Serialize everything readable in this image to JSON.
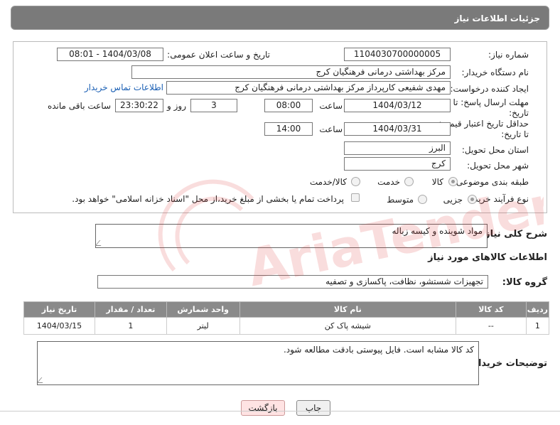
{
  "header": {
    "title": "جزئیات اطلاعات نیاز"
  },
  "form": {
    "need_number": {
      "label": "شماره نیاز:",
      "value": "1104030700000005"
    },
    "announce_datetime": {
      "label": "تاریخ و ساعت اعلان عمومی:",
      "value": "1404/03/08 - 08:01"
    },
    "buyer_org": {
      "label": "نام دستگاه خریدار:",
      "value": "مرکز بهداشتی درمانی فرهنگیان کرج"
    },
    "requester": {
      "label": "ایجاد کننده درخواست:",
      "value": "مهدی شفیعی کارپرداز مرکز بهداشتی درمانی فرهنگیان کرج",
      "contact_link": "اطلاعات تماس خریدار"
    },
    "reply_deadline": {
      "label_line1": "مهلت ارسال پاسخ: تا",
      "label_line2": "تاریخ:",
      "date": "1404/03/12",
      "time_label": "ساعت",
      "time": "08:00",
      "days_value": "3",
      "days_label": "روز و",
      "remaining_time": "23:30:22",
      "remaining_label": "ساعت باقی مانده"
    },
    "price_validity": {
      "label_line1": "حداقل تاریخ اعتبار قیمت:",
      "label_line2": "تا تاریخ:",
      "date": "1404/03/31",
      "time_label": "ساعت",
      "time": "14:00"
    },
    "delivery_province": {
      "label": "استان محل تحویل:",
      "value": "البرز"
    },
    "delivery_city": {
      "label": "شهر محل تحویل:",
      "value": "کرج"
    },
    "category": {
      "label": "طبقه بندی موضوعی:",
      "options": [
        "کالا",
        "خدمت",
        "کالا/خدمت"
      ],
      "selected": "کالا"
    },
    "purchase_type": {
      "label": "نوع فرآیند خرید :",
      "options": [
        "جزیی",
        "متوسط"
      ],
      "selected": "جزیی",
      "payment_note": "پرداخت تمام یا بخشی از مبلغ خرید،از محل \"اسناد خزانه اسلامی\" خواهد بود."
    }
  },
  "description": {
    "label": "شرح کلی نیاز:",
    "value": "مواد شوینده و کیسه زباله"
  },
  "goods_section": {
    "title": "اطلاعات کالاهای مورد نیاز"
  },
  "goods_group": {
    "label": "گروه کالا:",
    "value": "تجهیزات شستشو، نظافت، پاکسازی و تصفیه"
  },
  "table": {
    "headers": [
      "ردیف",
      "کد کالا",
      "نام کالا",
      "واحد شمارش",
      "تعداد / مقدار",
      "تاریخ نیاز"
    ],
    "rows": [
      {
        "row": "1",
        "code": "--",
        "name": "شیشه پاک کن",
        "unit": "لیتر",
        "qty": "1",
        "date": "1404/03/15"
      }
    ]
  },
  "buyer_notes": {
    "label": "توضیحات خریدار:",
    "value": "کد کالا مشابه است. فایل پیوستی بادقت مطالعه شود."
  },
  "buttons": {
    "print": "چاپ",
    "back": "بازگشت"
  },
  "watermark": {
    "brand": "AriaTender.net"
  },
  "colors": {
    "header_bg": "#7a7a7a",
    "table_header_bg": "#8a8a8a",
    "link": "#1a5fb4",
    "back_button_bg": "#ffe3e3"
  }
}
